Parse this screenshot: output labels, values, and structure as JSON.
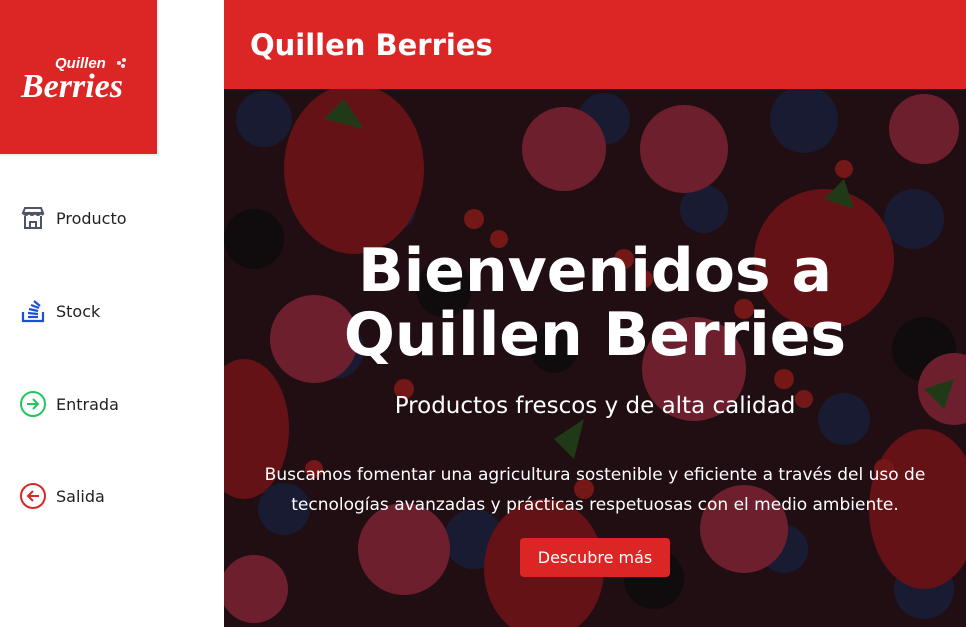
{
  "logo": {
    "line1": "Quillen",
    "line2": "Berries"
  },
  "header": {
    "brand": "Quillen Berries"
  },
  "sidebar": {
    "items": [
      {
        "label": "Producto",
        "icon": "store-icon"
      },
      {
        "label": "Stock",
        "icon": "stack-icon"
      },
      {
        "label": "Entrada",
        "icon": "arrow-right-circle-icon",
        "color": "#22c55e"
      },
      {
        "label": "Salida",
        "icon": "arrow-left-circle-icon",
        "color": "#dc2626"
      }
    ]
  },
  "hero": {
    "title": "Bienvenidos a Quillen Berries",
    "subtitle": "Productos frescos y de alta calidad",
    "description": "Buscamos fomentar una agricultura sostenible y eficiente a través del uso de tecnologías avanzadas y prácticas respetuosas con el medio ambiente.",
    "cta": "Descubre más"
  },
  "colors": {
    "accent": "#dc2626"
  }
}
